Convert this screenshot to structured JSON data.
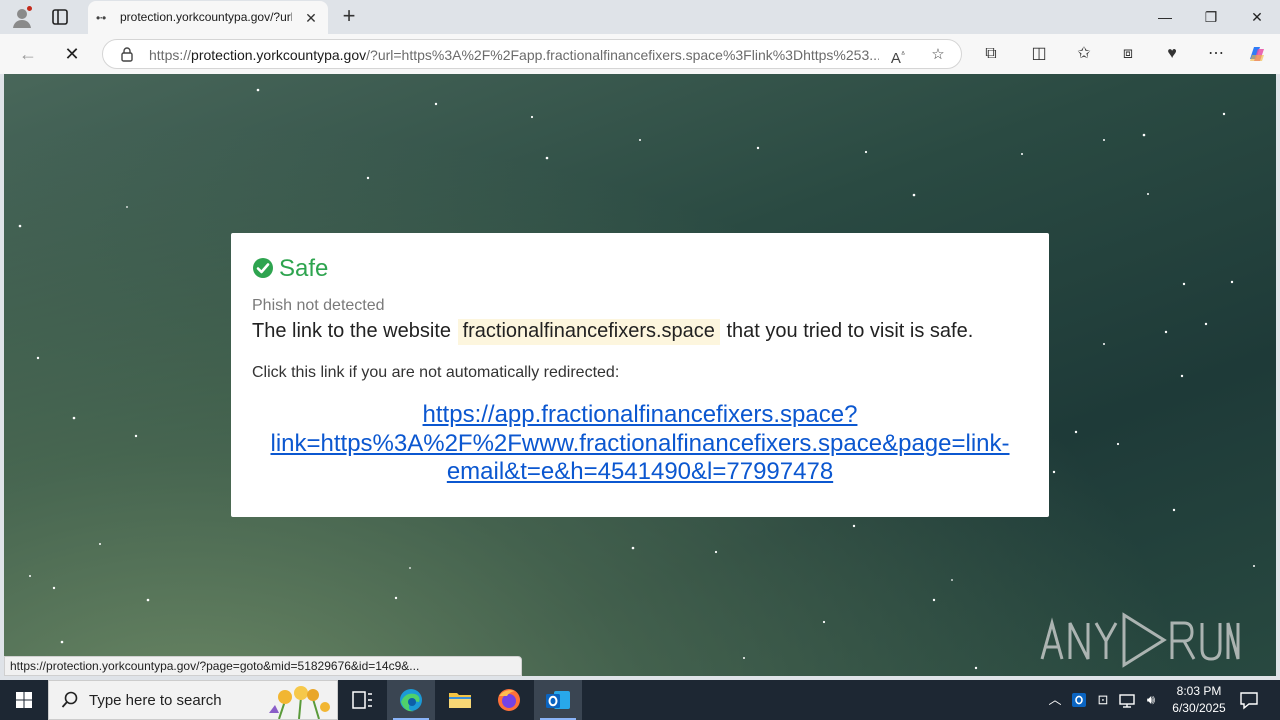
{
  "browser": {
    "tab_title": "protection.yorkcountypa.gov/?url",
    "tab_favicon": "loading-dots",
    "new_tab_symbol": "+",
    "url_host": "protection.yorkcountypa.gov",
    "url_scheme": "https://",
    "url_rest": "/?url=https%3A%2F%2Fapp.fractionalfinancefixers.space%3Flink%3Dhttps%253...",
    "status_bar_text": "https://protection.yorkcountypa.gov/?page=goto&mid=51829676&id=14c9&..."
  },
  "page": {
    "verdict": "Safe",
    "verdict_color": "#2ea44f",
    "subtitle": "Phish not detected",
    "statement_prefix": "The link to the website",
    "domain": "fractionalfinancefixers.space",
    "statement_suffix": "that you tried to visit is safe.",
    "hint": "Click this link if you are not automatically redirected:",
    "redirect_link": "https://app.fractionalfinancefixers.space?link=https%3A%2F%2Fwww.fractionalfinancefixers.space&page=link-email&t=e&h=4541490&l=77997478",
    "redirect_lines": [
      "https://app.fractionalfinancefixers.space?",
      "link=https%3A%2F%2Fwww.fractionalfinancefixers.space&page=link-",
      "email&t=e&h=4541490&l=77997478"
    ],
    "watermark": "ANY RUN"
  },
  "taskbar": {
    "search_placeholder": "Type here to search",
    "time": "8:03 PM",
    "date": "6/30/2025"
  }
}
